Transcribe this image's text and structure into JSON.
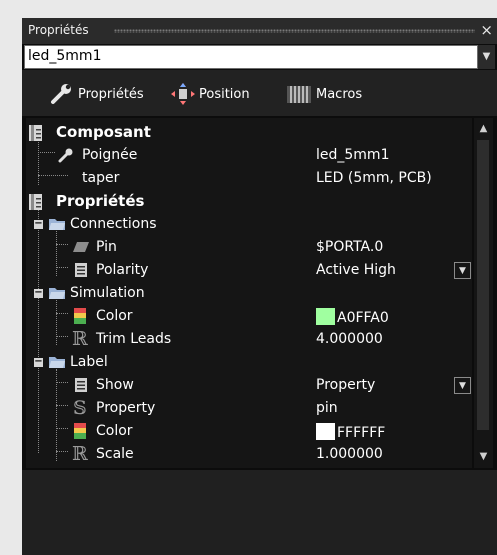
{
  "window": {
    "title": "Propriétés",
    "close_glyph": "×"
  },
  "selector": {
    "value": "led_5mm1"
  },
  "toolbar": {
    "buttons": [
      {
        "label": "Propriétés",
        "icon": "wrench-icon"
      },
      {
        "label": "Position",
        "icon": "move-arrows-icon"
      },
      {
        "label": "Macros",
        "icon": "macros-icon"
      }
    ]
  },
  "tree": {
    "composant": {
      "label": "Composant",
      "rows": [
        {
          "label": "Poignée",
          "value": "led_5mm1"
        },
        {
          "label": "taper",
          "value": "LED (5mm, PCB)"
        }
      ]
    },
    "proprietes": {
      "label": "Propriétés",
      "groups": [
        {
          "label": "Connections",
          "rows": [
            {
              "label": "Pin",
              "value": "$PORTA.0"
            },
            {
              "label": "Polarity",
              "value": "Active High"
            }
          ]
        },
        {
          "label": "Simulation",
          "rows": [
            {
              "label": "Color",
              "value": "A0FFA0",
              "swatch": "#A0FFA0"
            },
            {
              "label": "Trim Leads",
              "value": "4.000000"
            }
          ]
        },
        {
          "label": "Label",
          "rows": [
            {
              "label": "Show",
              "value": "Property"
            },
            {
              "label": "Property",
              "value": "pin"
            },
            {
              "label": "Color",
              "value": "FFFFFF",
              "swatch": "#FFFFFF"
            },
            {
              "label": "Scale",
              "value": "1.000000"
            }
          ]
        }
      ]
    }
  },
  "colors": {
    "background": "#0c0c0c",
    "panel": "#151515",
    "text": "#ffffff"
  }
}
